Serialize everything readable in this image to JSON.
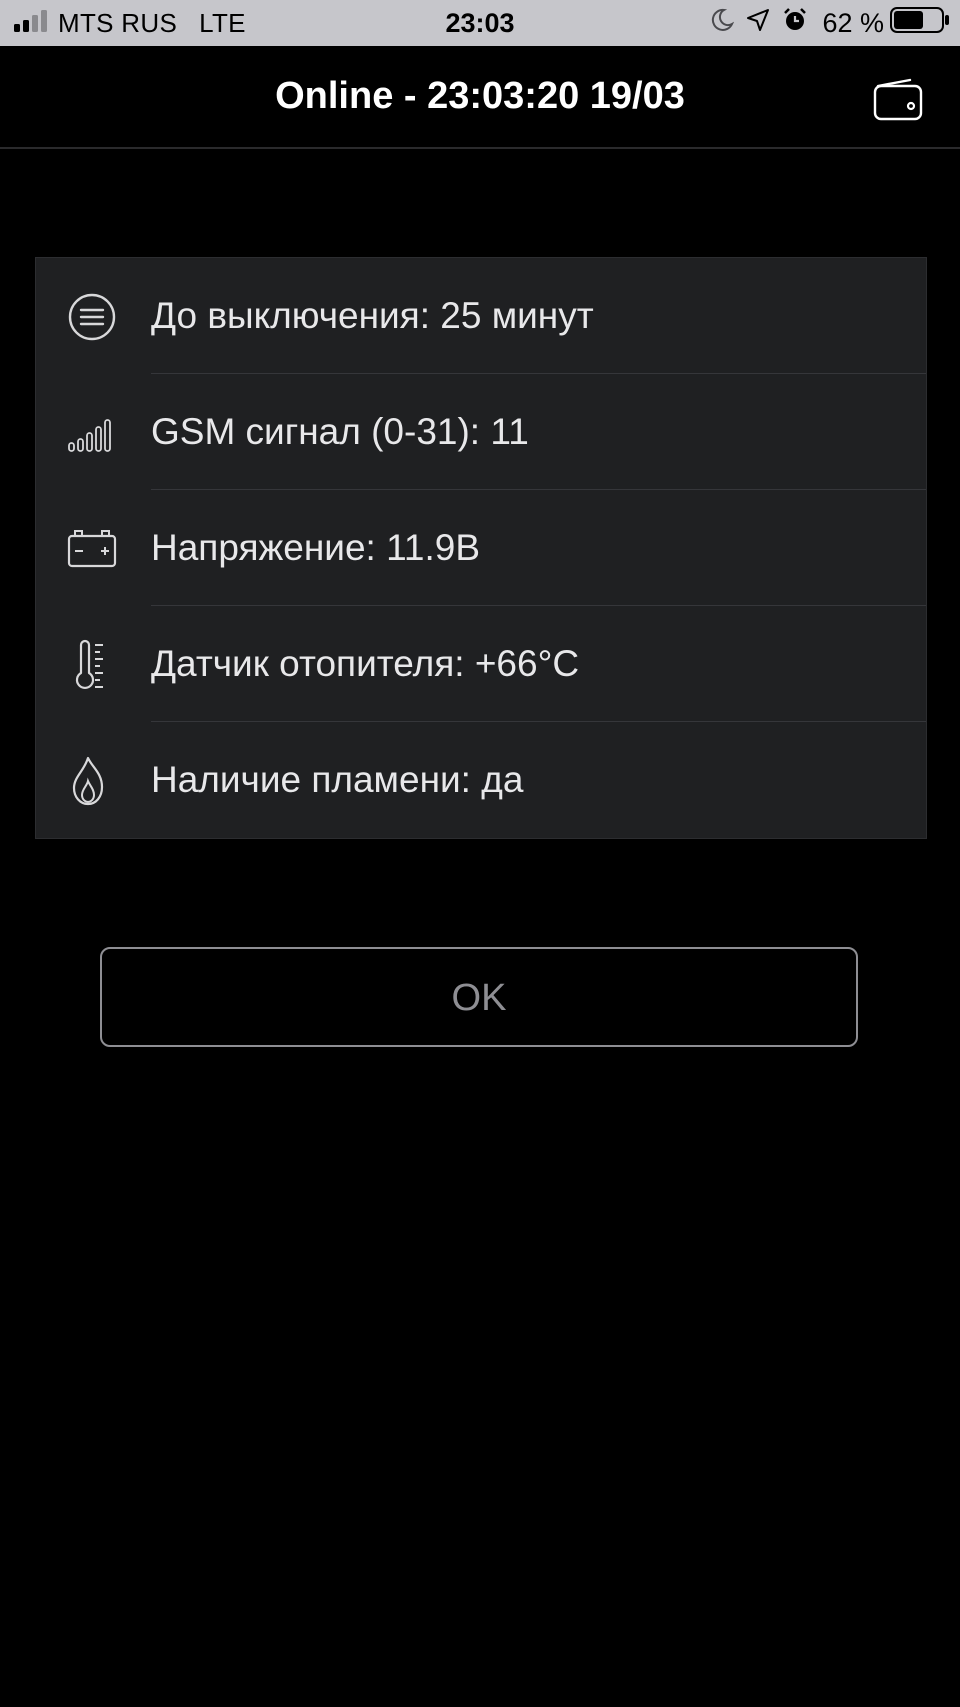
{
  "status_bar": {
    "carrier": "MTS RUS",
    "network": "LTE",
    "time": "23:03",
    "battery_percent": "62 %",
    "battery_level": 0.62,
    "icons": [
      "cellular-signal-icon",
      "moon-icon",
      "location-arrow-icon",
      "alarm-clock-icon",
      "battery-icon"
    ]
  },
  "nav": {
    "title": "Online - 23:03:20 19/03",
    "action_icon": "wallet-icon"
  },
  "info": {
    "rows": [
      {
        "icon": "menu-circle-icon",
        "text": "До выключения: 25 минут"
      },
      {
        "icon": "signal-bars-icon",
        "text": "GSM сигнал (0-31): 11"
      },
      {
        "icon": "car-battery-icon",
        "text": "Напряжение: 11.9В"
      },
      {
        "icon": "thermometer-icon",
        "text": "Датчик отопителя: +66°С"
      },
      {
        "icon": "flame-icon",
        "text": "Наличие пламени: да"
      }
    ]
  },
  "ok_button": {
    "label": "OK"
  },
  "colors": {
    "background": "#000000",
    "status_bar": "#c6c6cb",
    "card": "#1f2022",
    "text": "#e8e8ea",
    "button_outline": "#8e8e93"
  }
}
